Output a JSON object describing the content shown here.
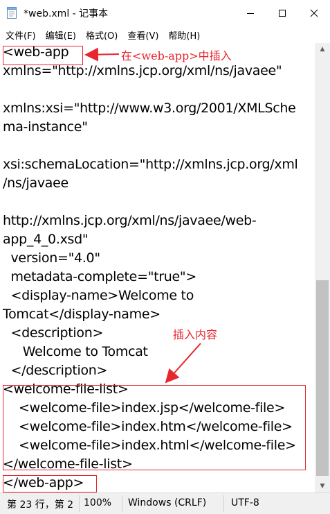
{
  "window": {
    "title": "*web.xml - 记事本",
    "icon": "notepad-icon",
    "controls": [
      "minimize-icon",
      "maximize-icon",
      "close-icon"
    ]
  },
  "menu": {
    "file": "文件(F)",
    "edit": "编辑(E)",
    "format": "格式(O)",
    "view": "查看(V)",
    "help": "帮助(H)"
  },
  "editor": {
    "lines": [
      "<web-app",
      "xmlns=\"http://xmlns.jcp.org/xml/ns/javaee\"",
      "",
      "xmlns:xsi=\"http://www.w3.org/2001/XMLSche",
      "ma-instance\"",
      "",
      "xsi:schemaLocation=\"http://xmlns.jcp.org/xml",
      "/ns/javaee",
      "",
      "http://xmlns.jcp.org/xml/ns/javaee/web-",
      "app_4_0.xsd\"",
      "  version=\"4.0\"",
      "  metadata-complete=\"true\">",
      "  <display-name>Welcome to",
      "Tomcat</display-name>",
      "  <description>",
      "     Welcome to Tomcat",
      "  </description>",
      "<welcome-file-list>",
      "    <welcome-file>index.jsp</welcome-file>",
      "    <welcome-file>index.htm</welcome-file>",
      "    <welcome-file>index.html</welcome-file>",
      "</welcome-file-list>",
      "</web-app>"
    ]
  },
  "annotations": {
    "insert_in_webapp": "在<web-app>中插入",
    "insert_content": "插入内容",
    "color": "#e8262d"
  },
  "statusbar": {
    "position": "第 23 行，第 2",
    "zoom": "100%",
    "line_ending": "Windows (CRLF)",
    "encoding": "UTF-8"
  }
}
